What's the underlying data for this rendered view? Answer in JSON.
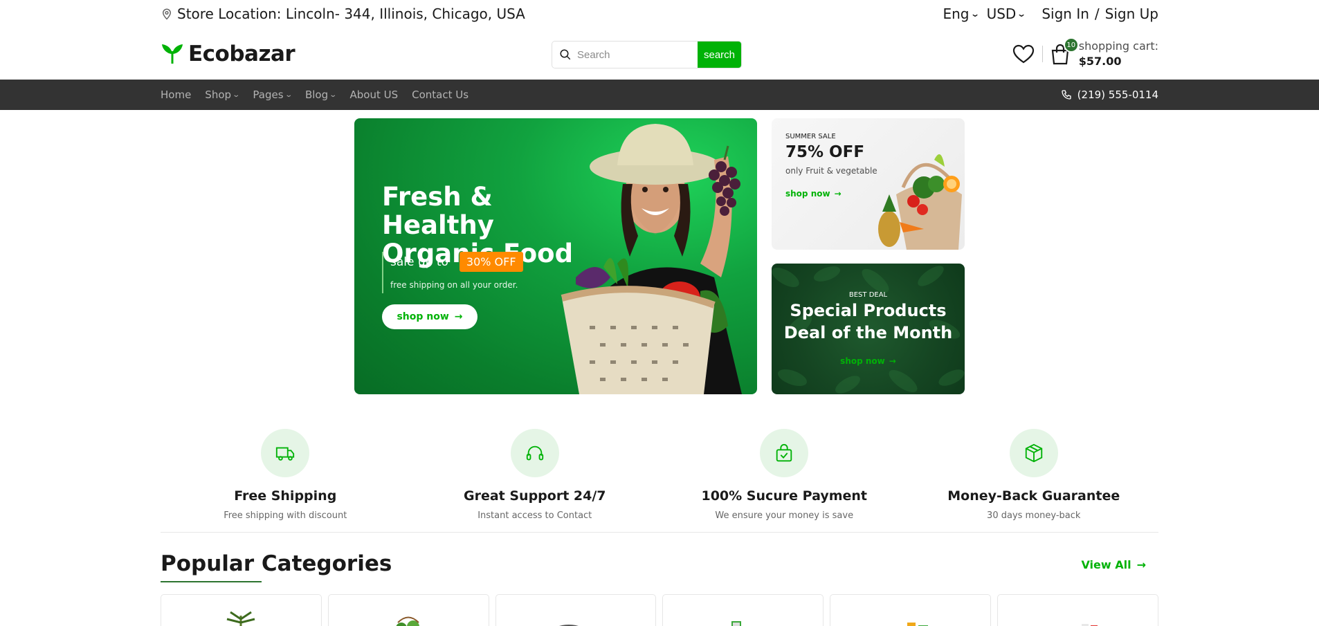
{
  "topbar": {
    "location": "Store Location: Lincoln- 344, Illinois, Chicago, USA",
    "language": "Eng",
    "currency": "USD",
    "sign_in": "Sign In",
    "separator": "/",
    "sign_up": "Sign Up"
  },
  "header": {
    "logo": "Ecobazar",
    "search_placeholder": "Search",
    "search_button": "search",
    "cart_count": "10",
    "cart_label": "shopping cart:",
    "cart_total": "$57.00"
  },
  "nav": {
    "items": [
      {
        "label": "Home",
        "dropdown": false
      },
      {
        "label": "Shop",
        "dropdown": true
      },
      {
        "label": "Pages",
        "dropdown": true
      },
      {
        "label": "Blog",
        "dropdown": true
      },
      {
        "label": "About US",
        "dropdown": false
      },
      {
        "label": "Contact Us",
        "dropdown": false
      }
    ],
    "phone": "(219) 555-0114"
  },
  "hero": {
    "title": "Fresh & Healthy Organic Food",
    "sale_prefix": "sale up to",
    "sale_badge": "30% OFF",
    "shipping_note": "free shipping on all your order.",
    "cta": "shop now"
  },
  "banner_summer": {
    "tag": "SUMMER SALE",
    "headline": "75% OFF",
    "subtitle": "only Fruit & vegetable",
    "cta": "shop now"
  },
  "banner_deal": {
    "tag": "BEST DEAL",
    "headline": "Special Products Deal of the Month",
    "cta": "shop now"
  },
  "features": [
    {
      "title": "Free Shipping",
      "subtitle": "Free shipping with discount",
      "icon": "truck-icon"
    },
    {
      "title": "Great Support 24/7",
      "subtitle": "Instant access to Contact",
      "icon": "headphones-icon"
    },
    {
      "title": "100% Sucure Payment",
      "subtitle": "We ensure your money is save",
      "icon": "shopping-bag-check-icon"
    },
    {
      "title": "Money-Back Guarantee",
      "subtitle": "30 days money-back",
      "icon": "package-icon"
    }
  ],
  "categories": {
    "title": "Popular Categories",
    "view_all": "View All"
  },
  "colors": {
    "brand_green": "#00b207",
    "dark_green": "#2c742f",
    "nav_bg": "#333333",
    "sale_orange": "#ff8a00"
  }
}
